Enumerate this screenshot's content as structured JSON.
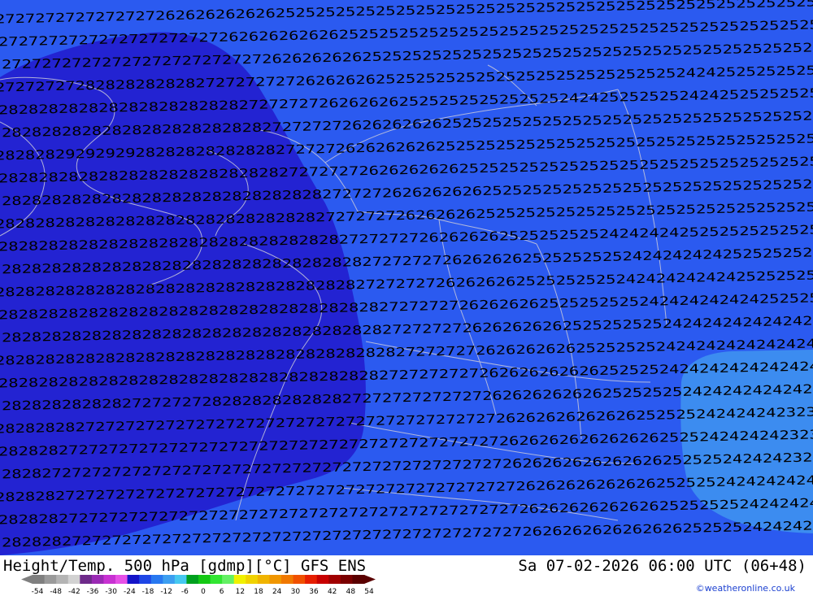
{
  "title": {
    "left": "Height/Temp. 500 hPa [gdmp][°C] GFS ENS",
    "right": "Sa 07-02-2026 06:00 UTC (06+48)"
  },
  "credit": "©weatheronline.co.uk",
  "map": {
    "regions": [
      {
        "name": "deep-blue-zone",
        "color": "#2323d2"
      },
      {
        "name": "medium-blue-zone",
        "color": "#2b5af0"
      },
      {
        "name": "light-blue-zone",
        "color": "#3c8cf0"
      }
    ],
    "contour_value_rows": [
      "2727272727272727262626262626252525252525252525252525252525252525252525252525252525",
      "2727272727272727272727262626262626252525252525252525252525252525252525252525252525",
      "2727272727272727272727272726262626262525252525252525252525252525252525252525252525",
      "2727272728282828282827272727272626262625252525252525252525252525252524242525252525",
      "2828282828282828282828282727272726262626252525252525252524242525252524242525252525",
      "2828282828282828282828282827272727262626262625252525252525252525252525252525252525",
      "2828282929292928282828282828272727262626262625252525252525252525252525252525252525",
      "2828282828282828282828282828272727272626262626252525252525252525252525252525252525",
      "2828282828282828282828282828282827272726262626262525252525252525252525252525252525",
      "2828282828282828282828282828282827272727262626262525252525252525252525252525252525",
      "2828282828282828282828282828282828272727272626262625252525252424242425252525252525",
      "2828282828282828282828282828282828282727272726262626252525252524242424242525252525",
      "2828282828282828282828282828282828282727272726262626252525252524242424242425252525",
      "2828282828282828282828282828282828282827272727262626262525252525242424242424252525",
      "2828282828282828282828282828282828282827272727262626262625252525252424242424242424",
      "2828282828282828282828282828282828282828272727272626262626252525252424242424242424",
      "2828282828282828282828282828282828282827272727272626262626262525252424242424242424",
      "2828282828282727272728282828282828272727272727272626262626262525252524242424242424",
      "2828282827272727272727272727272727272727272727272726262626262626252525242424242323",
      "2828282727272727272727272727272727272727272727272726262626262626262525242424242323",
      "2828272727272727272727272727272727272727272727272726262626262626262525252424242323",
      "2828282727272727272727272727272727272727272727272727262626262626262525252424242424",
      "2828282727272727272727272727272727272727272727272727262626262626262525252524242424",
      "2828282727272727272727272727272727272727272727272727262626262626262625252524242424"
    ]
  },
  "legend": {
    "tick_labels": [
      "-54",
      "-48",
      "-42",
      "-36",
      "-30",
      "-24",
      "-18",
      "-12",
      "-6",
      "0",
      "6",
      "12",
      "18",
      "24",
      "30",
      "36",
      "42",
      "48",
      "54"
    ],
    "colors": [
      "#7f7f7f",
      "#9a9a9a",
      "#b4b4b4",
      "#d2d2d2",
      "#6e2a8a",
      "#9a2ab4",
      "#c832d2",
      "#e650e6",
      "#1414c8",
      "#1e46e6",
      "#2878f0",
      "#3c9ef0",
      "#46c8f0",
      "#00a01e",
      "#14c814",
      "#32e632",
      "#64f064",
      "#f0f000",
      "#f0d200",
      "#f0b400",
      "#f09600",
      "#f07800",
      "#f05000",
      "#e61e00",
      "#c80000",
      "#a00000",
      "#7a0000",
      "#5a0000"
    ]
  }
}
